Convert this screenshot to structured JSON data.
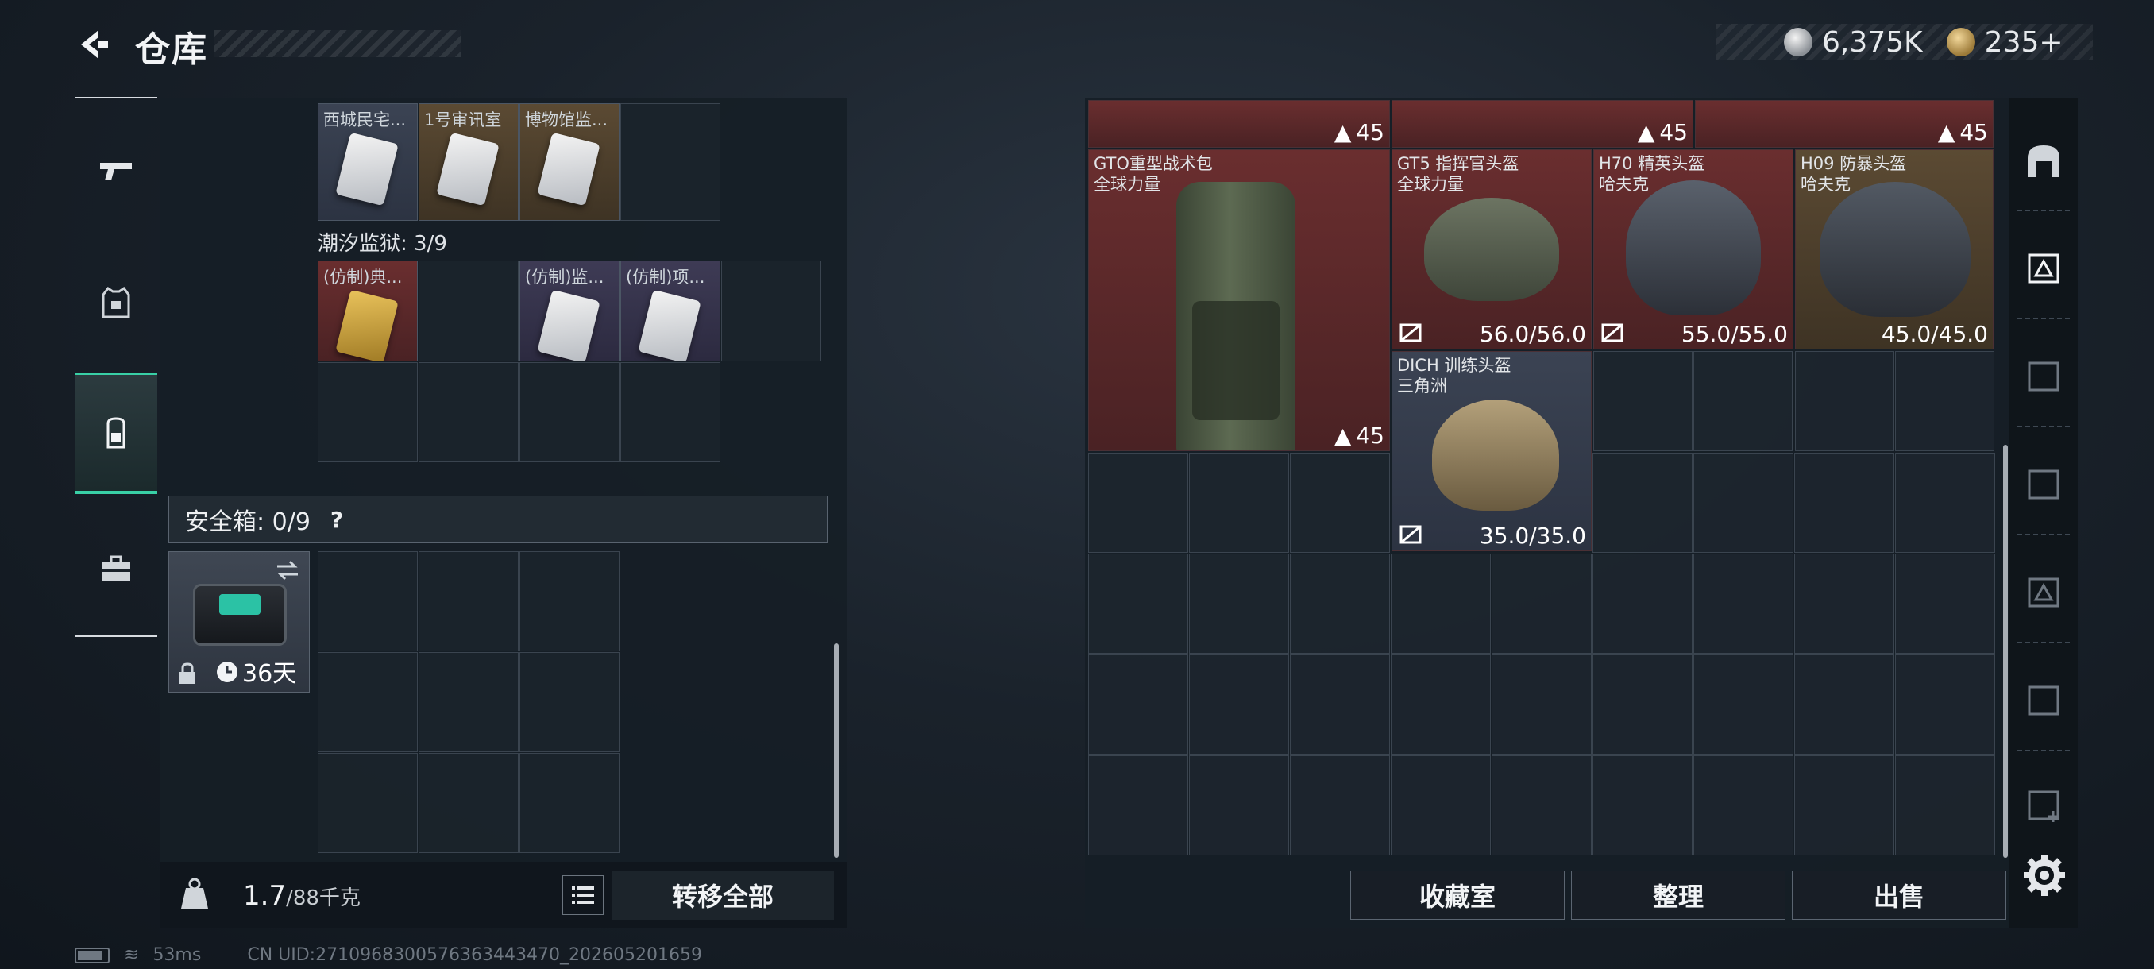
{
  "header": {
    "title": "仓库",
    "silver": "6,375K",
    "gold": "235+"
  },
  "left_rail": {
    "items": [
      {
        "icon": "gun-icon"
      },
      {
        "icon": "armor-vest-icon"
      },
      {
        "icon": "backpack-icon",
        "active": true
      },
      {
        "icon": "toolbox-icon"
      }
    ]
  },
  "left_panel": {
    "row1_items": [
      {
        "label": "西城民宅...",
        "bg": "blue"
      },
      {
        "label": "1号审讯室",
        "bg": "gold"
      },
      {
        "label": "博物馆监...",
        "bg": "gold"
      }
    ],
    "prison_label": "潮汐监狱: 3/9",
    "prison_items": [
      {
        "label": "(仿制)典...",
        "bg": "red",
        "card": "gold"
      },
      {
        "label": "(仿制)监...",
        "bg": "purple",
        "card": "white"
      },
      {
        "label": "(仿制)项...",
        "bg": "purple",
        "card": "white"
      }
    ],
    "safe_box": {
      "label": "安全箱: 0/9",
      "help": "?",
      "days": "36天"
    },
    "weight": {
      "current": "1.7",
      "max": "/88千克"
    },
    "transfer_all": "转移全部"
  },
  "right_panel": {
    "top_counts": [
      "45",
      "45",
      "45"
    ],
    "items": [
      {
        "name": "GTO重型战术包",
        "sub": "全球力量",
        "capacity": "45"
      },
      {
        "name": "GT5 指挥官头盔",
        "sub": "全球力量",
        "durability": "56.0/56.0"
      },
      {
        "name": "H70 精英头盔",
        "sub": "哈夫克",
        "durability": "55.0/55.0"
      },
      {
        "name": "H09 防暴头盔",
        "sub": "哈夫克",
        "durability": "45.0/45.0"
      },
      {
        "name": "DICH 训练头盔",
        "sub": "三角洲",
        "durability": "35.0/35.0"
      }
    ],
    "buttons": {
      "collection": "收藏室",
      "organize": "整理",
      "sell": "出售"
    }
  },
  "status_bar": {
    "ping": "53ms",
    "uid": "CN UID:2710968300576363443470_202605201659"
  },
  "colors": {
    "accent": "#39d0a6",
    "red_item": "#6a2e2f",
    "gold_item": "#5b4a33",
    "purple_item": "#3e3b55"
  }
}
